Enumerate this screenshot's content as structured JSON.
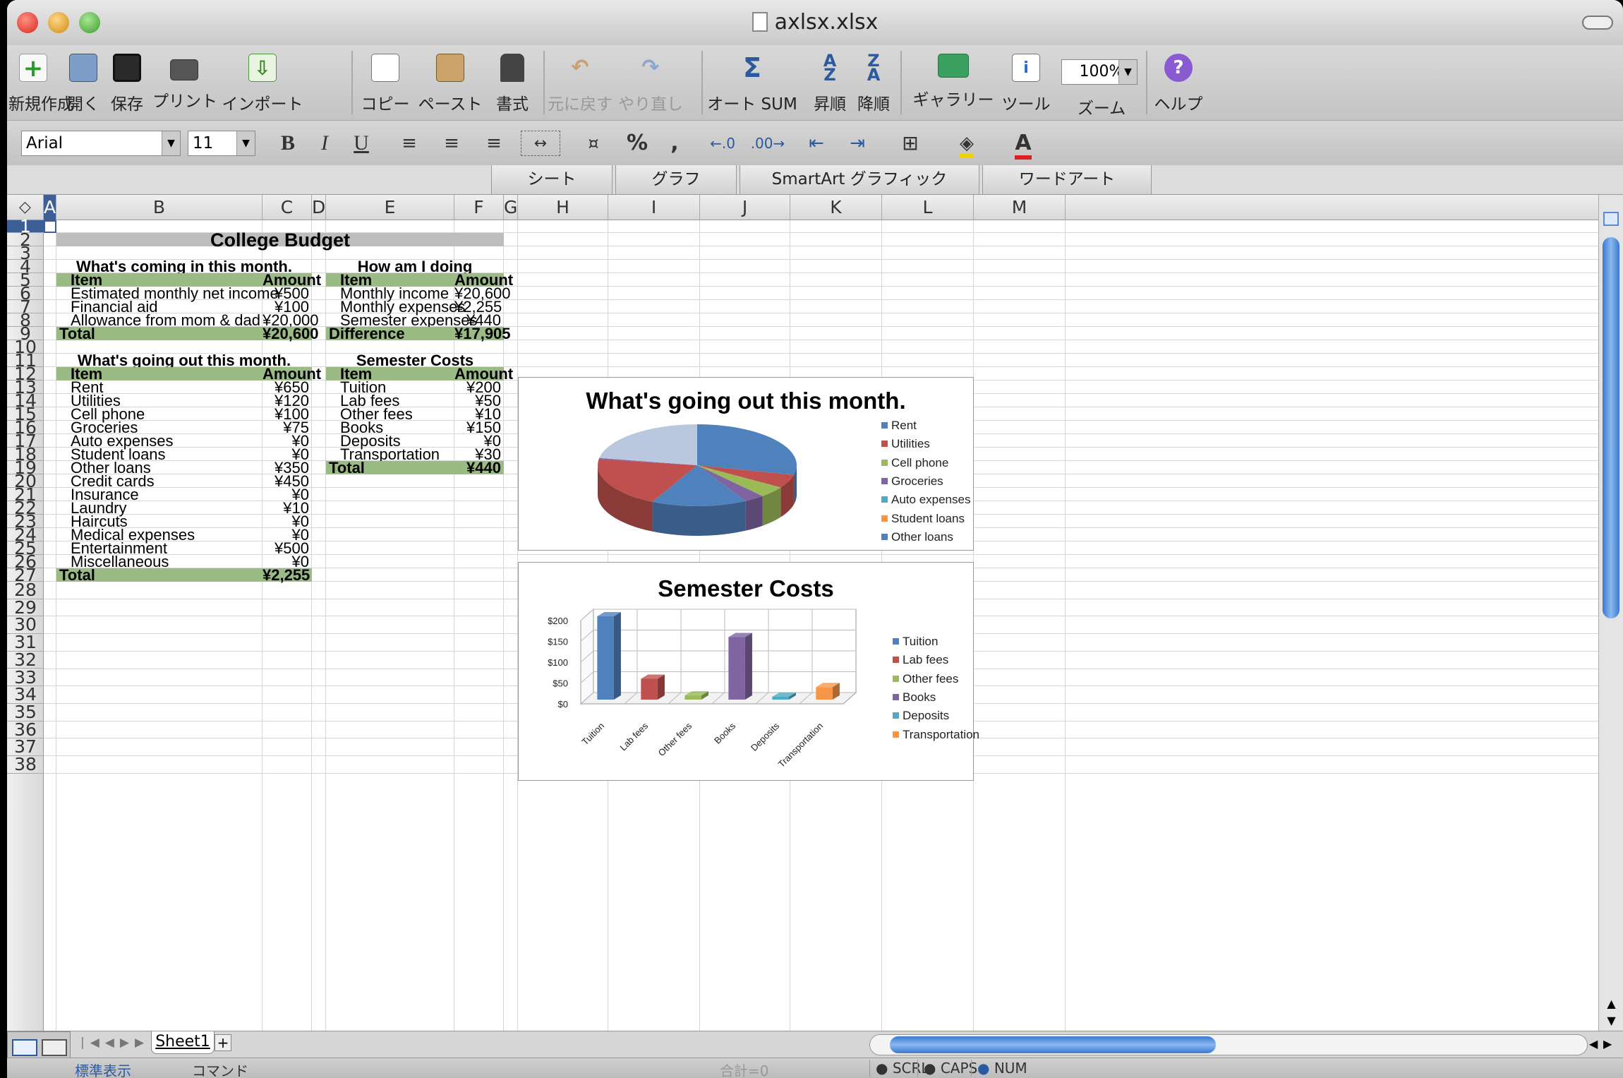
{
  "window": {
    "title": "axlsx.xlsx"
  },
  "toolbar": {
    "new": "新規作成",
    "open": "開く",
    "save": "保存",
    "print": "プリント",
    "import": "インポート",
    "copy": "コピー",
    "paste": "ペースト",
    "format": "書式",
    "undo": "元に戻す",
    "redo": "やり直し",
    "autosum": "オート SUM",
    "sort_asc": "昇順",
    "sort_desc": "降順",
    "gallery": "ギャラリー",
    "tools": "ツール",
    "zoom": "ズーム",
    "help": "ヘルプ",
    "zoom_value": "100%"
  },
  "format_bar": {
    "font": "Arial",
    "size": "11",
    "bold": "B",
    "italic": "I",
    "underline": "U",
    "percent": "%",
    "comma": ",",
    "font_color": "A"
  },
  "ribbon": {
    "tabs": [
      "シート",
      "グラフ",
      "SmartArt グラフィック",
      "ワードアート"
    ]
  },
  "columns": [
    "A",
    "B",
    "C",
    "D",
    "E",
    "F",
    "G",
    "H",
    "I",
    "J",
    "K",
    "L",
    "M"
  ],
  "rows": [
    "1",
    "2",
    "3",
    "4",
    "5",
    "6",
    "7",
    "8",
    "9",
    "10",
    "11",
    "12",
    "13",
    "14",
    "15",
    "16",
    "17",
    "18",
    "19",
    "20",
    "21",
    "22",
    "23",
    "24",
    "25",
    "26",
    "27",
    "28",
    "29",
    "30",
    "31",
    "32",
    "33",
    "34",
    "35",
    "36",
    "37",
    "38"
  ],
  "sheet": {
    "title": "College Budget",
    "income": {
      "heading": "What's coming in this month.",
      "col_item": "Item",
      "col_amount": "Amount",
      "rows": [
        {
          "item": "Estimated monthly net income",
          "amount": "¥500"
        },
        {
          "item": "Financial aid",
          "amount": "¥100"
        },
        {
          "item": "Allowance from mom & dad",
          "amount": "¥20,000"
        }
      ],
      "total_label": "Total",
      "total": "¥20,600"
    },
    "doing": {
      "heading": "How am I doing",
      "col_item": "Item",
      "col_amount": "Amount",
      "rows": [
        {
          "item": "Monthly income",
          "amount": "¥20,600"
        },
        {
          "item": "Monthly expenses",
          "amount": "¥2,255"
        },
        {
          "item": "Semester expenses",
          "amount": "¥440"
        }
      ],
      "total_label": "Difference",
      "total": "¥17,905"
    },
    "expenses": {
      "heading": "What's going out this month.",
      "col_item": "Item",
      "col_amount": "Amount",
      "rows": [
        {
          "item": "Rent",
          "amount": "¥650"
        },
        {
          "item": "Utilities",
          "amount": "¥120"
        },
        {
          "item": "Cell phone",
          "amount": "¥100"
        },
        {
          "item": "Groceries",
          "amount": "¥75"
        },
        {
          "item": "Auto expenses",
          "amount": "¥0"
        },
        {
          "item": "Student loans",
          "amount": "¥0"
        },
        {
          "item": "Other loans",
          "amount": "¥350"
        },
        {
          "item": "Credit cards",
          "amount": "¥450"
        },
        {
          "item": "Insurance",
          "amount": "¥0"
        },
        {
          "item": "Laundry",
          "amount": "¥10"
        },
        {
          "item": "Haircuts",
          "amount": "¥0"
        },
        {
          "item": "Medical expenses",
          "amount": "¥0"
        },
        {
          "item": "Entertainment",
          "amount": "¥500"
        },
        {
          "item": "Miscellaneous",
          "amount": "¥0"
        }
      ],
      "total_label": "Total",
      "total": "¥2,255"
    },
    "semester": {
      "heading": "Semester Costs",
      "col_item": "Item",
      "col_amount": "Amount",
      "rows": [
        {
          "item": "Tuition",
          "amount": "¥200"
        },
        {
          "item": "Lab fees",
          "amount": "¥50"
        },
        {
          "item": "Other fees",
          "amount": "¥10"
        },
        {
          "item": "Books",
          "amount": "¥150"
        },
        {
          "item": "Deposits",
          "amount": "¥0"
        },
        {
          "item": "Transportation",
          "amount": "¥30"
        }
      ],
      "total_label": "Total",
      "total": "¥440"
    }
  },
  "chart_data": [
    {
      "type": "pie",
      "title": "What's going out this month.",
      "legend": "right",
      "categories": [
        "Rent",
        "Utilities",
        "Cell phone",
        "Groceries",
        "Auto expenses",
        "Student loans",
        "Other loans",
        "Credit cards",
        "Insurance",
        "Laundry",
        "Haircuts",
        "Medical expenses",
        "Entertainment",
        "Miscellaneous"
      ],
      "values": [
        650,
        120,
        100,
        75,
        0,
        0,
        350,
        450,
        0,
        10,
        0,
        0,
        500,
        0
      ],
      "legend_entries": [
        "Rent",
        "Utilities",
        "Cell phone",
        "Groceries",
        "Auto expenses",
        "Student loans",
        "Other loans"
      ],
      "colors": [
        "#4f81bd",
        "#c0504d",
        "#9bbb59",
        "#8064a2",
        "#4bacc6",
        "#f79646",
        "#4f81bd",
        "#c0504d",
        "#9bbb59",
        "#8064a2",
        "#4bacc6",
        "#f79646",
        "#b9c7df",
        "#c0504d"
      ]
    },
    {
      "type": "bar",
      "title": "Semester Costs",
      "legend": "right",
      "categories": [
        "Tuition",
        "Lab fees",
        "Other fees",
        "Books",
        "Deposits",
        "Transportation"
      ],
      "values": [
        200,
        50,
        10,
        150,
        0,
        30
      ],
      "ylim": [
        0,
        200
      ],
      "yticks": [
        "$200",
        "$150",
        "$100",
        "$50",
        "$0"
      ],
      "colors": [
        "#4f81bd",
        "#c0504d",
        "#9bbb59",
        "#8064a2",
        "#4bacc6",
        "#f79646"
      ]
    }
  ],
  "tabs": {
    "sheet1": "Sheet1",
    "add": "+"
  },
  "status": {
    "view": "標準表示",
    "mode": "コマンド",
    "sum": "合計=0",
    "scrl": "SCRL",
    "caps": "CAPS",
    "num": "NUM"
  }
}
